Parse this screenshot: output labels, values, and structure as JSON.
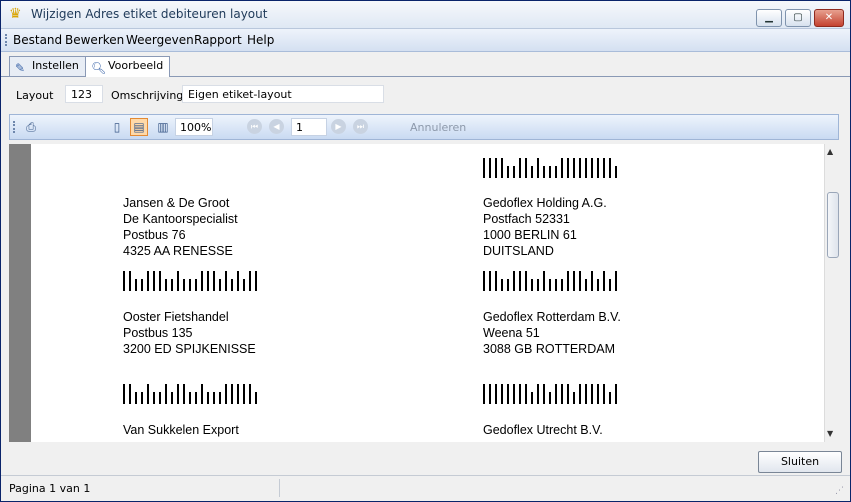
{
  "window": {
    "title": "Wijzigen Adres etiket debiteuren layout"
  },
  "menu": {
    "items": [
      "Bestand",
      "Bewerken",
      "Weergeven",
      "Rapport",
      "Help"
    ]
  },
  "tabs": [
    {
      "label": "Instellen",
      "active": false
    },
    {
      "label": "Voorbeeld",
      "active": true
    }
  ],
  "fields": {
    "layout_label": "Layout",
    "layout_value": "123",
    "description_label": "Omschrijving",
    "description_value": "Eigen etiket-layout"
  },
  "toolbar": {
    "zoom": "100%",
    "page": "1",
    "cancel_label": "Annuleren"
  },
  "labels": [
    {
      "lines": [
        "Jansen & De Groot",
        "De Kantoorspecialist",
        "Postbus 76",
        "4325 AA RENESSE"
      ]
    },
    {
      "lines": [
        "Gedoflex Holding A.G.",
        "Postfach 52331",
        "1000  BERLIN 61",
        "DUITSLAND"
      ]
    },
    {
      "lines": [
        "Ooster Fietshandel",
        "Postbus 135",
        "3200 ED SPIJKENISSE"
      ]
    },
    {
      "lines": [
        "Gedoflex Rotterdam B.V.",
        "Weena 51",
        "3088 GB ROTTERDAM"
      ]
    },
    {
      "lines": [
        "Van Sukkelen Export"
      ]
    },
    {
      "lines": [
        "Gedoflex Utrecht B.V."
      ]
    }
  ],
  "buttons": {
    "close": "Sluiten"
  },
  "status": {
    "page_info": "Pagina 1 van 1"
  }
}
